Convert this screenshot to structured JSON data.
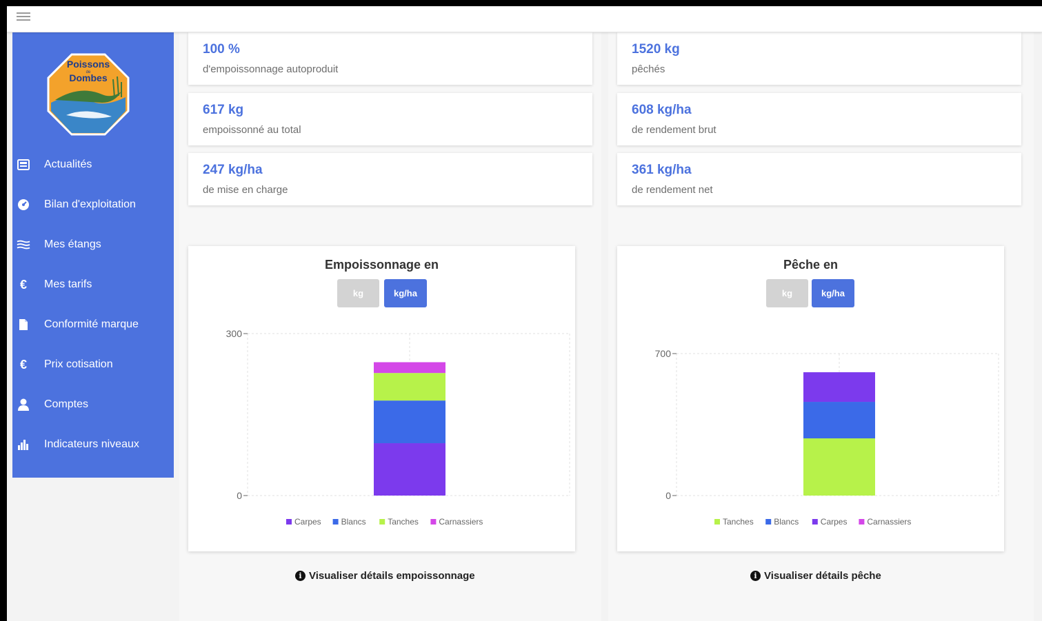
{
  "sidebar": {
    "logo_text": "Poissons de Dombes",
    "items": [
      {
        "label": "Actualités",
        "icon": "newspaper-icon"
      },
      {
        "label": "Bilan d'exploitation",
        "icon": "dashboard-icon"
      },
      {
        "label": "Mes étangs",
        "icon": "water-icon"
      },
      {
        "label": "Mes tarifs",
        "icon": "euro-icon"
      },
      {
        "label": "Conformité marque",
        "icon": "file-icon"
      },
      {
        "label": "Prix cotisation",
        "icon": "euro-icon"
      },
      {
        "label": "Comptes",
        "icon": "user-icon"
      },
      {
        "label": "Indicateurs niveaux",
        "icon": "bar-chart-icon"
      }
    ]
  },
  "stats_left": [
    {
      "value": "100 %",
      "label": "d'empoissonnage autoproduit"
    },
    {
      "value": "617 kg",
      "label": "empoissonné au total"
    },
    {
      "value": "247 kg/ha",
      "label": "de mise en charge"
    }
  ],
  "stats_right": [
    {
      "value": "1520 kg",
      "label": "pêchés"
    },
    {
      "value": "608 kg/ha",
      "label": "de rendement brut"
    },
    {
      "value": "361 kg/ha",
      "label": "de rendement net"
    }
  ],
  "charts": {
    "left": {
      "title": "Empoissonnage en",
      "unit_kg": "kg",
      "unit_kgha": "kg/ha",
      "details_link": "Visualiser détails empoissonnage"
    },
    "right": {
      "title": "Pêche en",
      "unit_kg": "kg",
      "unit_kgha": "kg/ha",
      "details_link": "Visualiser détails pêche"
    }
  },
  "colors": {
    "accent": "#4c72de",
    "carpes": "#7c3aed",
    "blancs": "#3b6ae8",
    "tanches": "#b7f24a",
    "carnassiers": "#d447e8"
  },
  "chart_data": [
    {
      "type": "bar",
      "stacked": true,
      "title": "Empoissonnage en",
      "ylim": [
        0,
        300
      ],
      "yticks": [
        "0",
        "300"
      ],
      "categories": [
        ""
      ],
      "series": [
        {
          "name": "Carpes",
          "color": "#7c3aed",
          "values": [
            97
          ]
        },
        {
          "name": "Blancs",
          "color": "#3b6ae8",
          "values": [
            79
          ]
        },
        {
          "name": "Tanches",
          "color": "#b7f24a",
          "values": [
            51
          ]
        },
        {
          "name": "Carnassiers",
          "color": "#d447e8",
          "values": [
            20
          ]
        }
      ],
      "grid": true,
      "legend": "bottom"
    },
    {
      "type": "bar",
      "stacked": true,
      "title": "Pêche en",
      "ylim": [
        0,
        700
      ],
      "yticks": [
        "0",
        "700"
      ],
      "categories": [
        ""
      ],
      "series": [
        {
          "name": "Tanches",
          "color": "#b7f24a",
          "values": [
            282
          ]
        },
        {
          "name": "Blancs",
          "color": "#3b6ae8",
          "values": [
            180
          ]
        },
        {
          "name": "Carpes",
          "color": "#7c3aed",
          "values": [
            146
          ]
        },
        {
          "name": "Carnassiers",
          "color": "#d447e8",
          "values": [
            0
          ]
        }
      ],
      "grid": true,
      "legend": "bottom"
    }
  ]
}
